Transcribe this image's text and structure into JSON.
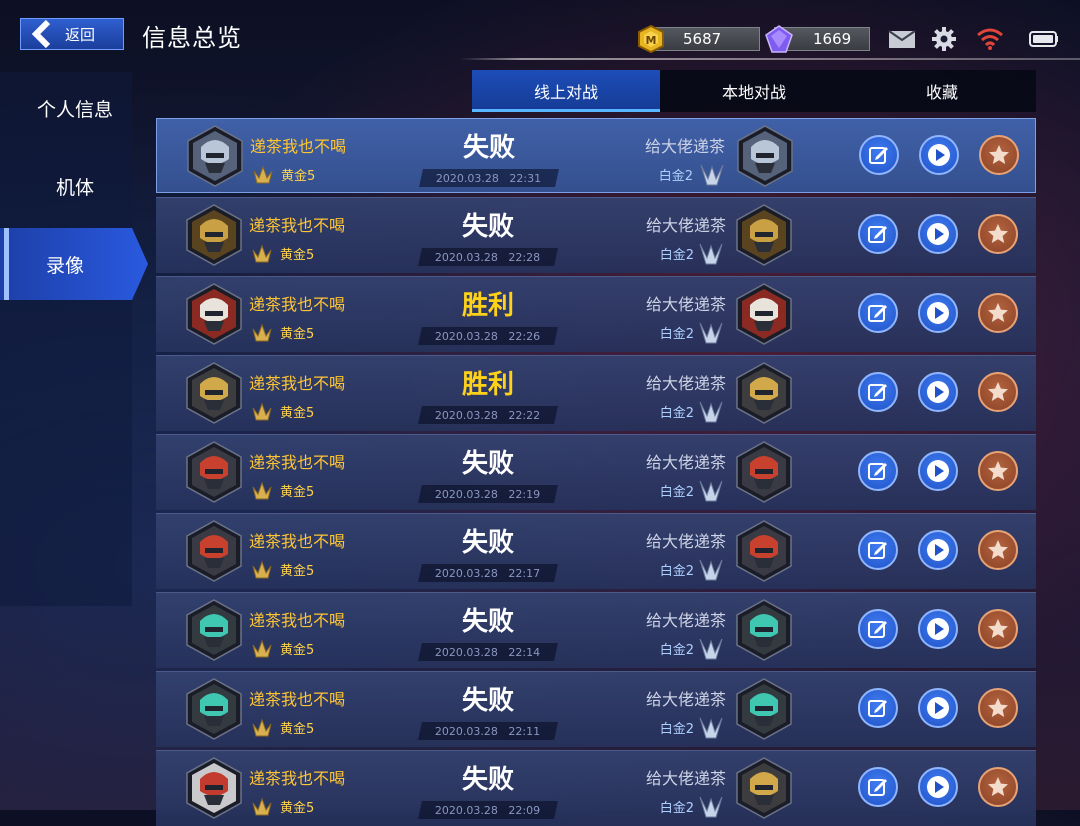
{
  "header": {
    "back_label": "返回",
    "title": "信息总览",
    "gold_amount": "5687",
    "gem_amount": "1669",
    "icons": [
      "mail-icon",
      "gear-icon",
      "wifi-icon",
      "battery-icon"
    ]
  },
  "sidebar": {
    "items": [
      {
        "label": "个人信息",
        "active": false
      },
      {
        "label": "机体",
        "active": false
      },
      {
        "label": "录像",
        "active": true
      }
    ]
  },
  "tabs": [
    {
      "label": "线上对战",
      "active": true
    },
    {
      "label": "本地对战",
      "active": false
    },
    {
      "label": "收藏",
      "active": false
    }
  ],
  "colors": {
    "win": "#ffd21a",
    "lose": "#ffffff",
    "accent": "#2a5ae0",
    "player_name": "#ffc533"
  },
  "records": [
    {
      "player": "递茶我也不喝",
      "rank": "黄金5",
      "result": "失败",
      "outcome": "lose",
      "date": "2020.03.28",
      "time": "22:31",
      "opponent": "给大佬递茶",
      "opp_rank": "白金2",
      "mech": "white-beast",
      "opp_mech": "white-beast"
    },
    {
      "player": "递茶我也不喝",
      "rank": "黄金5",
      "result": "失败",
      "outcome": "lose",
      "date": "2020.03.28",
      "time": "22:28",
      "opponent": "给大佬递茶",
      "opp_rank": "白金2",
      "mech": "gold-knight",
      "opp_mech": "gold-knight"
    },
    {
      "player": "递茶我也不喝",
      "rank": "黄金5",
      "result": "胜利",
      "outcome": "win",
      "date": "2020.03.28",
      "time": "22:26",
      "opponent": "给大佬递茶",
      "opp_rank": "白金2",
      "mech": "fox",
      "opp_mech": "fox"
    },
    {
      "player": "递茶我也不喝",
      "rank": "黄金5",
      "result": "胜利",
      "outcome": "win",
      "date": "2020.03.28",
      "time": "22:22",
      "opponent": "给大佬递茶",
      "opp_rank": "白金2",
      "mech": "gold-visor",
      "opp_mech": "gold-visor"
    },
    {
      "player": "递茶我也不喝",
      "rank": "黄金5",
      "result": "失败",
      "outcome": "lose",
      "date": "2020.03.28",
      "time": "22:19",
      "opponent": "给大佬递茶",
      "opp_rank": "白金2",
      "mech": "red-helmet",
      "opp_mech": "red-helmet"
    },
    {
      "player": "递茶我也不喝",
      "rank": "黄金5",
      "result": "失败",
      "outcome": "lose",
      "date": "2020.03.28",
      "time": "22:17",
      "opponent": "给大佬递茶",
      "opp_rank": "白金2",
      "mech": "red-helmet",
      "opp_mech": "red-helmet"
    },
    {
      "player": "递茶我也不喝",
      "rank": "黄金5",
      "result": "失败",
      "outcome": "lose",
      "date": "2020.03.28",
      "time": "22:14",
      "opponent": "给大佬递茶",
      "opp_rank": "白金2",
      "mech": "teal-mask",
      "opp_mech": "teal-mask"
    },
    {
      "player": "递茶我也不喝",
      "rank": "黄金5",
      "result": "失败",
      "outcome": "lose",
      "date": "2020.03.28",
      "time": "22:11",
      "opponent": "给大佬递茶",
      "opp_rank": "白金2",
      "mech": "teal-mask",
      "opp_mech": "teal-mask"
    },
    {
      "player": "递茶我也不喝",
      "rank": "黄金5",
      "result": "失败",
      "outcome": "lose",
      "date": "2020.03.28",
      "time": "22:09",
      "opponent": "给大佬递茶",
      "opp_rank": "白金2",
      "mech": "red-grill",
      "opp_mech": "gold-visor"
    }
  ]
}
